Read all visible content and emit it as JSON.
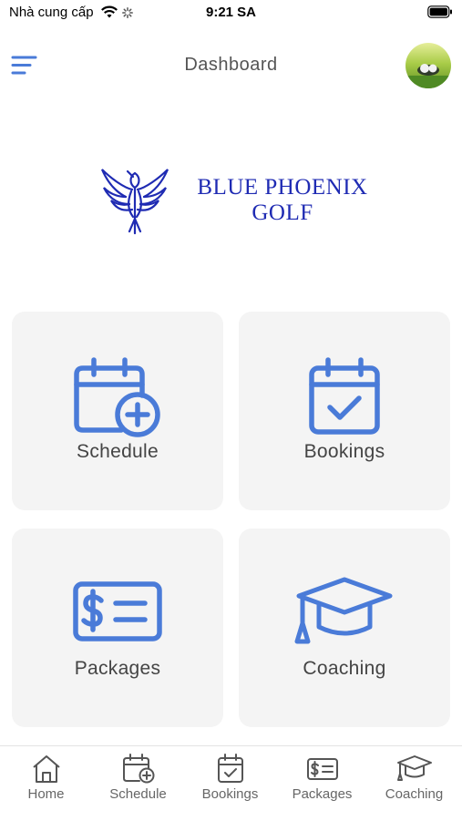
{
  "status_bar": {
    "carrier": "Nhà cung cấp",
    "time": "9:21 SA"
  },
  "header": {
    "title": "Dashboard",
    "menu_icon": "menu-icon",
    "avatar": "user-avatar"
  },
  "logo": {
    "line1": "BLUE PHOENIX",
    "line2": "GOLF",
    "brand_color": "#1f2bb3"
  },
  "tiles": [
    {
      "label": "Schedule",
      "icon": "calendar-plus-icon"
    },
    {
      "label": "Bookings",
      "icon": "calendar-check-icon"
    },
    {
      "label": "Packages",
      "icon": "dollar-ticket-icon"
    },
    {
      "label": "Coaching",
      "icon": "graduation-cap-icon"
    }
  ],
  "bottom_nav": [
    {
      "label": "Home",
      "icon": "home-icon"
    },
    {
      "label": "Schedule",
      "icon": "calendar-plus-icon"
    },
    {
      "label": "Bookings",
      "icon": "calendar-check-icon"
    },
    {
      "label": "Packages",
      "icon": "dollar-ticket-icon"
    },
    {
      "label": "Coaching",
      "icon": "graduation-cap-icon"
    }
  ],
  "colors": {
    "accent": "#4a7bd8",
    "tile_bg": "#f4f4f4",
    "nav_icon": "#555555"
  }
}
